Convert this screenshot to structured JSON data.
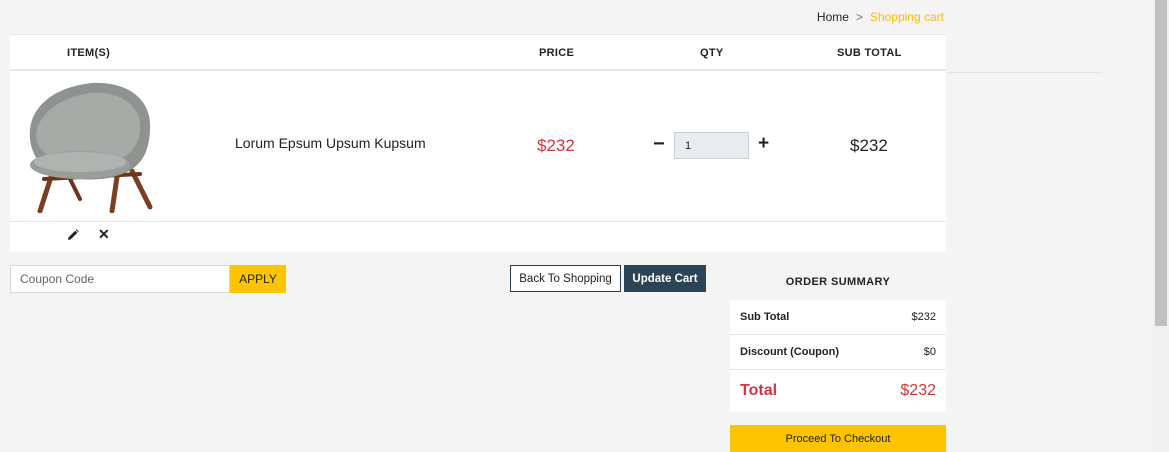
{
  "breadcrumb": {
    "home": "Home",
    "separator": ">",
    "current": "Shopping cart"
  },
  "cart": {
    "headers": {
      "items": "ITEM(S)",
      "price": "PRICE",
      "qty": "QTY",
      "subtotal": "SUB TOTAL"
    },
    "items": [
      {
        "name": "Lorum Epsum Upsum Kupsum",
        "price": "$232",
        "qty": "1",
        "subtotal": "$232",
        "image_icon": "armchair-image"
      }
    ],
    "qty_minus": "−",
    "qty_plus": "+",
    "remove_symbol": "✕"
  },
  "coupon": {
    "placeholder": "Coupon Code",
    "apply_label": "APPLY"
  },
  "buttons": {
    "back": "Back To Shopping",
    "update": "Update Cart",
    "checkout": "Proceed To Checkout"
  },
  "summary": {
    "title": "ORDER SUMMARY",
    "subtotal_label": "Sub Total",
    "subtotal_value": "$232",
    "discount_label": "Discount (Coupon)",
    "discount_value": "$0",
    "total_label": "Total",
    "total_value": "$232"
  },
  "colors": {
    "accent": "#ffc400",
    "price_red": "#d4343b",
    "dark_button": "#2c4556"
  }
}
